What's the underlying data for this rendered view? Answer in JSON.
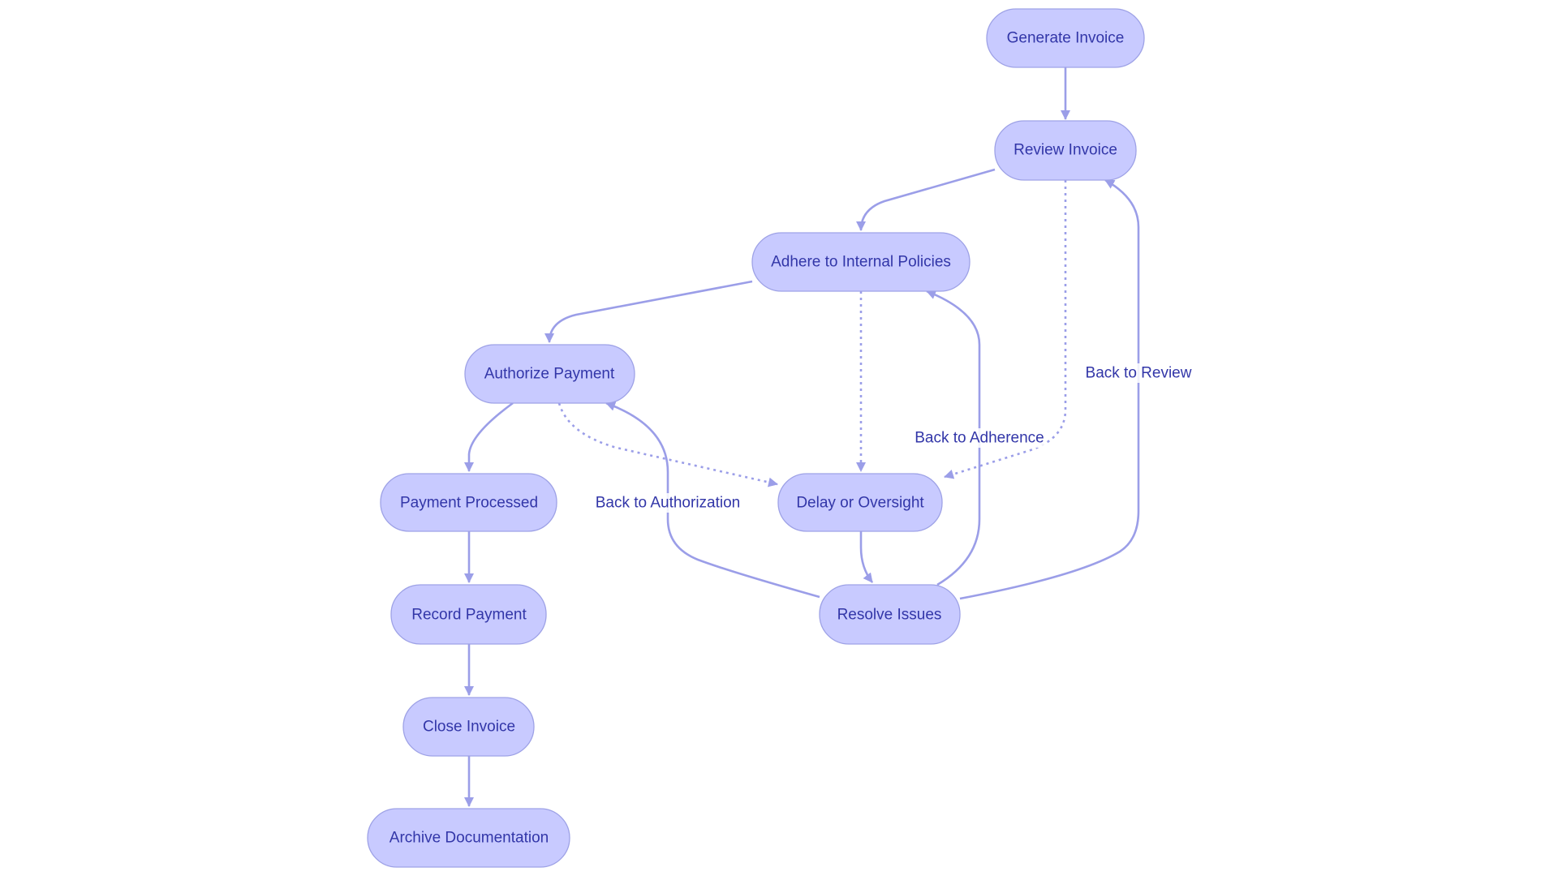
{
  "diagram": {
    "type": "flowchart",
    "colors": {
      "node_fill": "#c8caff",
      "node_stroke": "#9ea2e6",
      "edge": "#9b9ee8",
      "text": "#3236a8",
      "background": "#ffffff"
    },
    "nodes": [
      {
        "id": "generate",
        "label": "Generate Invoice"
      },
      {
        "id": "review",
        "label": "Review Invoice"
      },
      {
        "id": "adhere",
        "label": "Adhere to Internal Policies"
      },
      {
        "id": "authorize",
        "label": "Authorize Payment"
      },
      {
        "id": "processed",
        "label": "Payment Processed"
      },
      {
        "id": "delay",
        "label": "Delay or Oversight"
      },
      {
        "id": "resolve",
        "label": "Resolve Issues"
      },
      {
        "id": "record",
        "label": "Record Payment"
      },
      {
        "id": "close",
        "label": "Close Invoice"
      },
      {
        "id": "archive",
        "label": "Archive Documentation"
      }
    ],
    "edges": [
      {
        "from": "generate",
        "to": "review",
        "style": "solid",
        "label": ""
      },
      {
        "from": "review",
        "to": "adhere",
        "style": "solid",
        "label": ""
      },
      {
        "from": "adhere",
        "to": "authorize",
        "style": "solid",
        "label": ""
      },
      {
        "from": "authorize",
        "to": "processed",
        "style": "solid",
        "label": ""
      },
      {
        "from": "processed",
        "to": "record",
        "style": "solid",
        "label": ""
      },
      {
        "from": "record",
        "to": "close",
        "style": "solid",
        "label": ""
      },
      {
        "from": "close",
        "to": "archive",
        "style": "solid",
        "label": ""
      },
      {
        "from": "review",
        "to": "delay",
        "style": "dotted",
        "label": ""
      },
      {
        "from": "adhere",
        "to": "delay",
        "style": "dotted",
        "label": ""
      },
      {
        "from": "authorize",
        "to": "delay",
        "style": "dotted",
        "label": ""
      },
      {
        "from": "delay",
        "to": "resolve",
        "style": "solid",
        "label": ""
      },
      {
        "from": "resolve",
        "to": "review",
        "style": "solid",
        "label": "Back to Review"
      },
      {
        "from": "resolve",
        "to": "adhere",
        "style": "solid",
        "label": "Back to Adherence"
      },
      {
        "from": "resolve",
        "to": "authorize",
        "style": "solid",
        "label": "Back to Authorization"
      }
    ]
  }
}
